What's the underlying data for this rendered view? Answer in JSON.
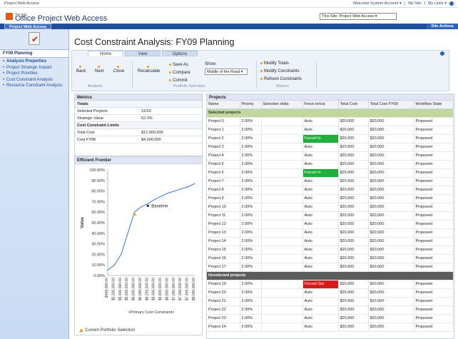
{
  "topbar": {
    "left": "Project Web Access",
    "welcome": "Welcome System Account ▾",
    "mysite": "My Site",
    "mylinks": "My Links ▾"
  },
  "header": {
    "brand_small": "Microsoft",
    "brand": "Office Project Web Access",
    "site_select": "This Site: Project Web Access"
  },
  "blueband": {
    "tab": "Project Web Access",
    "site_actions": "Site Actions"
  },
  "leftnav": {
    "section": "FY09 Planning",
    "items": [
      "Analysis Properties",
      "Project Strategic Impact",
      "Project Priorities",
      "Cost Constraint Analysis",
      "Resource Constraint Analysis"
    ]
  },
  "page": {
    "title": "Cost Constraint Analysis: FY09 Planning"
  },
  "ribbon": {
    "tabs": [
      "Home",
      "View",
      "Options"
    ],
    "analysis": {
      "back": "Back",
      "next": "Next",
      "close": "Close",
      "group": "Analysis"
    },
    "portfolio": {
      "recalculate": "Recalculate",
      "save_as": "Save As",
      "compare": "Compare",
      "commit": "Commit",
      "show_label": "Show:",
      "show_value": "Middle of the Road",
      "group": "Portfolio Selection"
    },
    "metrics": {
      "modify_totals": "Modify Totals",
      "modify_constraints": "Modify Constraints",
      "refresh_constraints": "Refresh Constraints",
      "group": "Metrics"
    }
  },
  "metrics": {
    "title": "Metrics",
    "totals_header": "Totals",
    "rows": [
      {
        "k": "Selected Projects",
        "v": "12/20"
      },
      {
        "k": "Strategic Value",
        "v": "62.3%"
      }
    ],
    "limits_header": "Cost Constraint Limits",
    "limit_rows": [
      {
        "k": "Total Cost",
        "v": "$12,000,000"
      },
      {
        "k": "Cost FY08",
        "v": "$4,000,000"
      }
    ]
  },
  "frontier": {
    "title": "Efficient Frontier",
    "legend": "Current Portfolio Selection"
  },
  "chart_data": {
    "type": "line",
    "title": "",
    "xlabel": "<Primary Cost Constraint>",
    "ylabel": "Value",
    "x": [
      4000000,
      5200000,
      5400000,
      5600000,
      5800000,
      6000000,
      6200000,
      6400000,
      6600000,
      6800000,
      7000000,
      7200000,
      7400000,
      8000000
    ],
    "series": [
      {
        "values": [
          5,
          10,
          20,
          40,
          60,
          65,
          68,
          72,
          75,
          78,
          80,
          82,
          84,
          87
        ]
      }
    ],
    "x_ticks": [
      "$400,000.00",
      "$5,200,000.00",
      "$5,400,000.00",
      "$5,600,000.00",
      "$5,800,000.00",
      "$6,000,000.00",
      "$6,200,000.00",
      "$6,400,000.00",
      "$6,600,000.00",
      "$6,800,000.00",
      "$7,000,000.00",
      "$7,200,000.00",
      "$7,400,000.00",
      "$8,000,000.00"
    ],
    "y_ticks": [
      "100.00%",
      "90.00%",
      "80.00%",
      "70.00%",
      "60.00%",
      "50.00%",
      "40.00%",
      "30.00%",
      "20.00%",
      "10.00%",
      "0.00%"
    ],
    "ylim": [
      0,
      100
    ],
    "baseline": {
      "label": "Baseline",
      "x_index": 6,
      "y": 66
    },
    "current": {
      "x_index": 4,
      "y": 58
    },
    "colors": {
      "line": "#4a7fd0",
      "current": "#e0a020"
    }
  },
  "projects": {
    "title": "Projects",
    "columns": [
      "Name",
      "Priority",
      "Selection delta",
      "Force in/out",
      "Total Cost",
      "Total Cost FY09",
      "Workflow State"
    ],
    "selected_label": "Selected projects",
    "unselected_label": "Unselected projects",
    "selected": [
      [
        "Project 0",
        "2.00%",
        "",
        "Auto",
        "$20,000",
        "$20,000",
        "Proposed"
      ],
      [
        "Project 1",
        "2.00%",
        "",
        "Auto",
        "$20,000",
        "$20,000",
        "Proposed"
      ],
      [
        "Project 2",
        "2.00%",
        "",
        "Forced In",
        "$20,000",
        "$20,000",
        "Proposed"
      ],
      [
        "Project 3",
        "2.00%",
        "",
        "Auto",
        "$20,000",
        "$20,000",
        "Proposed"
      ],
      [
        "Project 4",
        "2.00%",
        "",
        "Auto",
        "$20,000",
        "$20,000",
        "Proposed"
      ],
      [
        "Project 5",
        "2.00%",
        "",
        "Auto",
        "$20,000",
        "$20,000",
        "Proposed"
      ],
      [
        "Project 6",
        "2.00%",
        "",
        "Forced In",
        "$20,000",
        "$20,000",
        "Proposed"
      ],
      [
        "Project 7",
        "2.00%",
        "",
        "Auto",
        "$20,000",
        "$20,000",
        "Proposed"
      ],
      [
        "Project 8",
        "2.00%",
        "",
        "Auto",
        "$20,000",
        "$20,000",
        "Proposed"
      ],
      [
        "Project 9",
        "2.00%",
        "",
        "Auto",
        "$20,000",
        "$20,000",
        "Proposed"
      ],
      [
        "Project 10",
        "2.00%",
        "",
        "Auto",
        "$20,000",
        "$20,000",
        "Proposed"
      ],
      [
        "Project 11",
        "2.00%",
        "",
        "Auto",
        "$20,000",
        "$20,000",
        "Proposed"
      ],
      [
        "Project 12",
        "2.00%",
        "",
        "Auto",
        "$20,000",
        "$20,000",
        "Proposed"
      ],
      [
        "Project 13",
        "2.00%",
        "",
        "Auto",
        "$20,000",
        "$20,000",
        "Proposed"
      ],
      [
        "Project 14",
        "2.00%",
        "",
        "Auto",
        "$20,000",
        "$20,000",
        "Proposed"
      ],
      [
        "Project 15",
        "2.00%",
        "",
        "Auto",
        "$20,000",
        "$20,000",
        "Proposed"
      ],
      [
        "Project 16",
        "2.00%",
        "",
        "Auto",
        "$20,000",
        "$20,000",
        "Proposed"
      ],
      [
        "Project 17",
        "2.00%",
        "",
        "Auto",
        "$20,000",
        "$20,000",
        "Proposed"
      ]
    ],
    "unselected": [
      [
        "Project 19",
        "2.00%",
        "",
        "Forced Out",
        "$20,000",
        "$20,000",
        "Proposed"
      ],
      [
        "Project 20",
        "2.00%",
        "",
        "Auto",
        "$20,000",
        "$20,000",
        "Proposed"
      ],
      [
        "Project 21",
        "2.00%",
        "",
        "Auto",
        "$20,000",
        "$20,000",
        "Proposed"
      ],
      [
        "Project 22",
        "2.00%",
        "",
        "Auto",
        "$20,000",
        "$20,000",
        "Proposed"
      ],
      [
        "Project 23",
        "2.00%",
        "",
        "Auto",
        "$20,000",
        "$20,000",
        "Proposed"
      ],
      [
        "Project 24",
        "2.00%",
        "",
        "Auto",
        "$20,000",
        "$20,000",
        "Proposed"
      ]
    ]
  }
}
